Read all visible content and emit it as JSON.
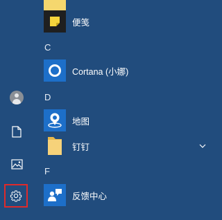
{
  "colors": {
    "menu_background": "#214c7d",
    "tile_blue": "#1d6fc9",
    "selection_outline": "#e02a2a"
  },
  "sections": {
    "c": "C",
    "d": "D",
    "f": "F"
  },
  "apps": {
    "sticky_notes": "便笺",
    "cortana": "Cortana (小娜)",
    "maps": "地图",
    "dingtalk": "钉钉",
    "feedback_hub": "反馈中心"
  },
  "rail": {
    "items": [
      "user-account",
      "documents",
      "pictures",
      "settings"
    ]
  }
}
